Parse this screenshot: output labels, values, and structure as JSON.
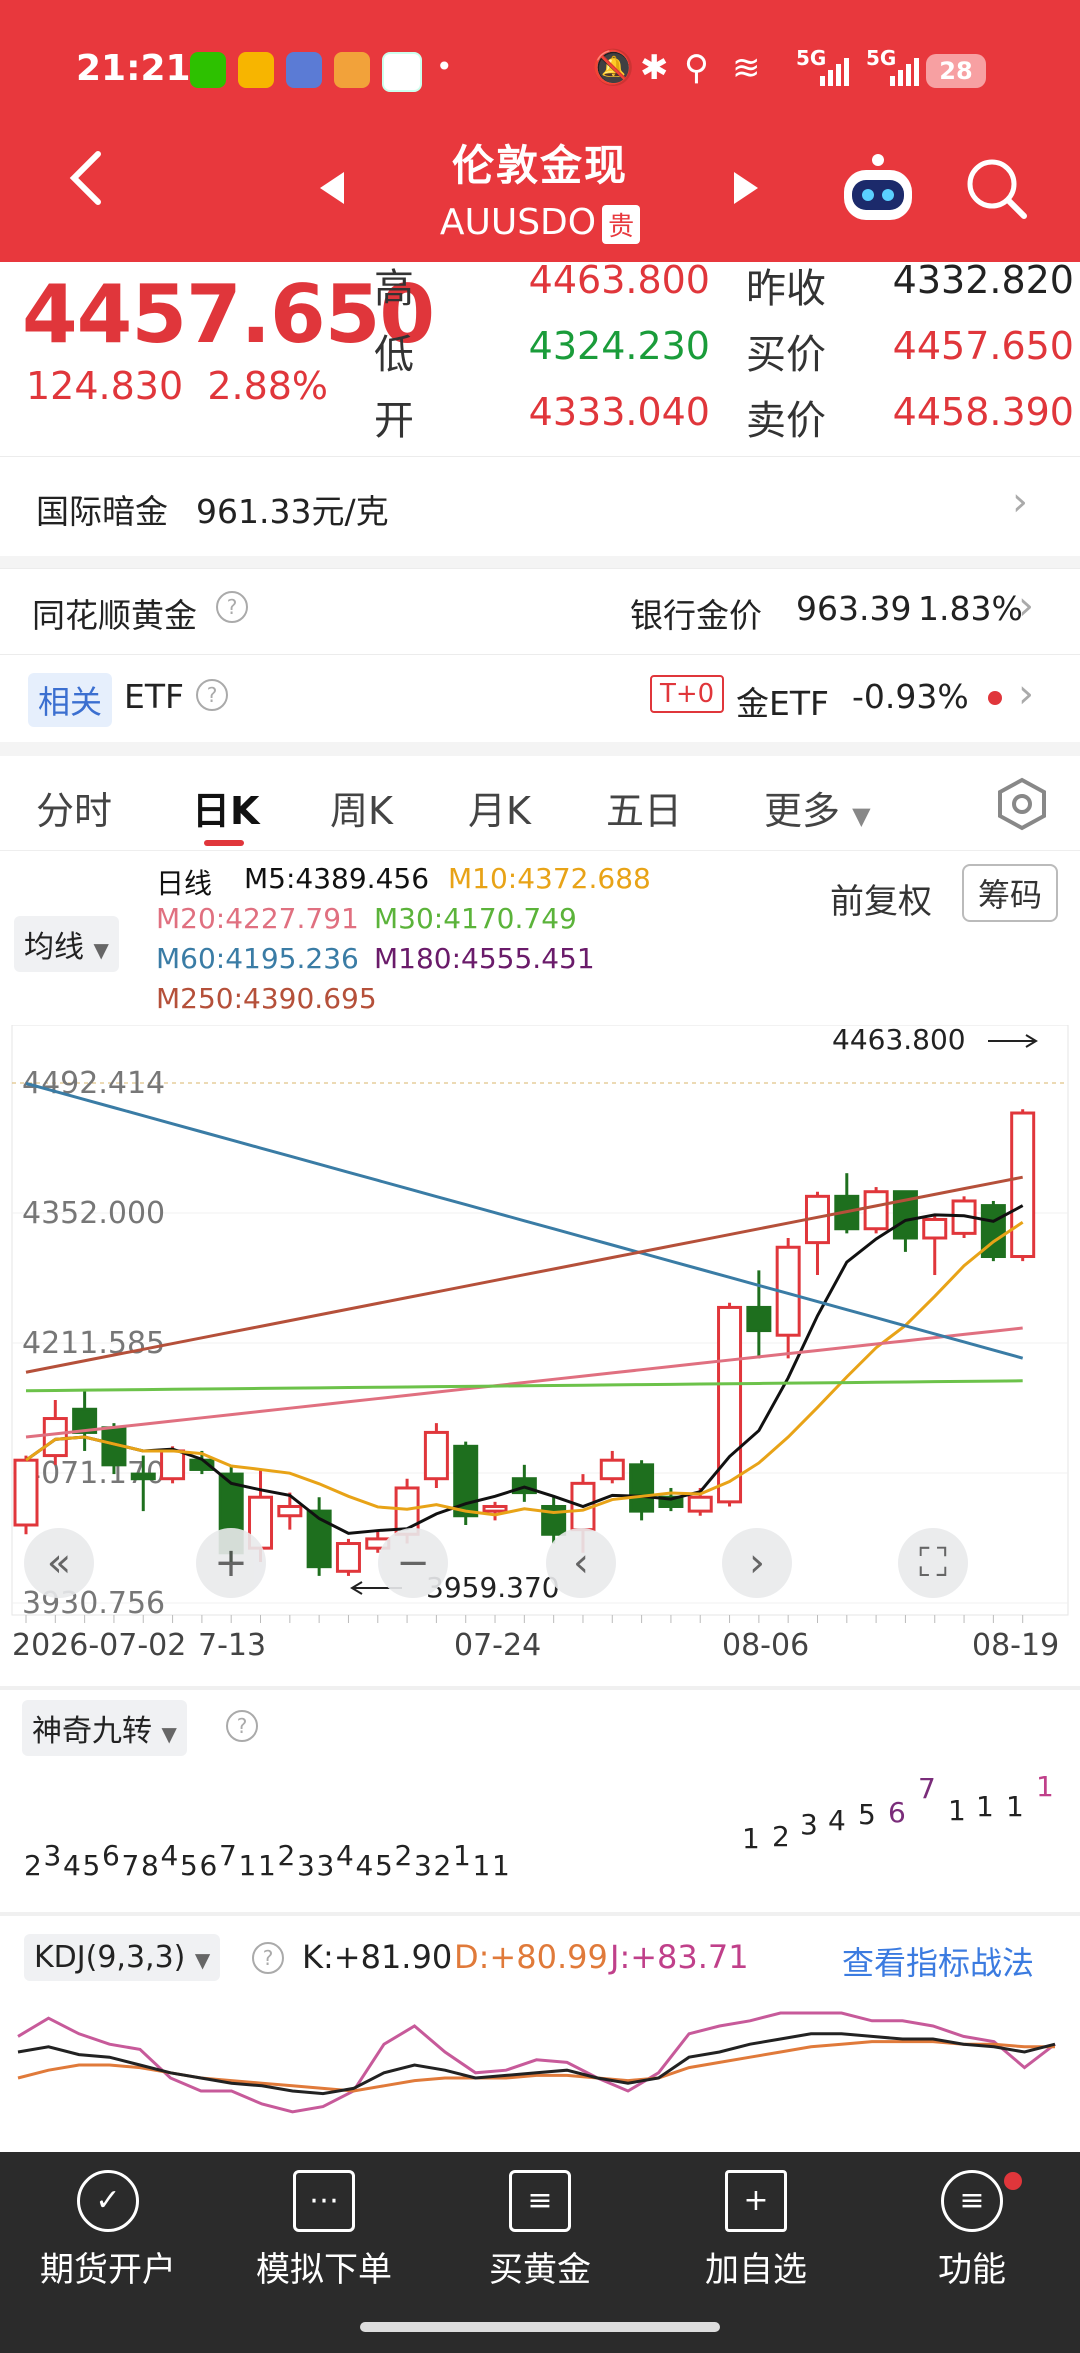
{
  "status_bar": {
    "time": "21:21",
    "dot": "•",
    "battery": "28",
    "signal1": "5G",
    "signal2": "5G"
  },
  "header": {
    "title": "伦敦金现",
    "symbol": "AUUSDO",
    "badge": "贵"
  },
  "quote": {
    "price": "4457.650",
    "change": "124.830",
    "change_pct": "2.88%",
    "high_label": "高",
    "high_value": "4463.800",
    "low_label": "低",
    "low_value": "4324.230",
    "open_label": "开",
    "open_value": "4333.040",
    "prev_close_label": "昨收",
    "prev_close_value": "4332.820",
    "bid_label": "买价",
    "bid_value": "4457.650",
    "ask_label": "卖价",
    "ask_value": "4458.390"
  },
  "intl_gold": {
    "label": "国际暗金",
    "value": "961.33元/克"
  },
  "ths_gold": {
    "label": "同花顺黄金",
    "bank_label": "银行金价",
    "bank_price": "963.39",
    "bank_pct": "1.83%"
  },
  "etf_row": {
    "tag": "相关",
    "label": "ETF",
    "tplus": "T+0",
    "name": "金ETF",
    "pct": "-0.93%"
  },
  "tabs": [
    "分时",
    "日K",
    "周K",
    "月K",
    "五日",
    "更多"
  ],
  "active_tab": "日K",
  "ma": {
    "title": "日线",
    "m5": "M5:4389.456",
    "m10": "M10:4372.688",
    "m20": "M20:4227.791",
    "m30": "M30:4170.749",
    "m60": "M60:4195.236",
    "m180": "M180:4555.451",
    "m250": "M250:4390.695"
  },
  "ma_selector": "均线",
  "fuquan": "前复权",
  "chouma": "筹码",
  "colors": {
    "red": "#e0363b",
    "green": "#1e6f1e",
    "m5": "#111111",
    "m10": "#e8a317",
    "m20": "#e07080",
    "m30": "#6cc24a",
    "m60": "#3a7ca5",
    "m180": "#6a1b6a",
    "m250": "#b5503a"
  },
  "chart_data": {
    "type": "candlestick",
    "y_ticks": [
      "4492.414",
      "4352.000",
      "4211.585",
      "4071.170",
      "3930.756"
    ],
    "x_labels": [
      "2026-07-02",
      "7-13",
      "07-24",
      "08-06",
      "08-19"
    ],
    "annotations": {
      "high": "4463.800",
      "low": "3959.370"
    },
    "ylim": [
      3930.756,
      4492.414
    ],
    "candles": [
      {
        "o": 4015,
        "c": 4085,
        "h": 4090,
        "l": 4005
      },
      {
        "o": 4090,
        "c": 4130,
        "h": 4150,
        "l": 4080
      },
      {
        "o": 4140,
        "c": 4115,
        "h": 4160,
        "l": 4095
      },
      {
        "o": 4120,
        "c": 4080,
        "h": 4125,
        "l": 4070
      },
      {
        "o": 4070,
        "c": 4065,
        "h": 4090,
        "l": 4030
      },
      {
        "o": 4065,
        "c": 4095,
        "h": 4100,
        "l": 4060
      },
      {
        "o": 4085,
        "c": 4075,
        "h": 4095,
        "l": 4070
      },
      {
        "o": 4070,
        "c": 3985,
        "h": 4080,
        "l": 3975
      },
      {
        "o": 3990,
        "c": 4045,
        "h": 4075,
        "l": 3975
      },
      {
        "o": 4025,
        "c": 4035,
        "h": 4050,
        "l": 4010
      },
      {
        "o": 4030,
        "c": 3970,
        "h": 4045,
        "l": 3960
      },
      {
        "o": 3965,
        "c": 3995,
        "h": 4000,
        "l": 3960
      },
      {
        "o": 3990,
        "c": 4000,
        "h": 4010,
        "l": 3985
      },
      {
        "o": 4005,
        "c": 4055,
        "h": 4065,
        "l": 3995
      },
      {
        "o": 4065,
        "c": 4115,
        "h": 4125,
        "l": 4055
      },
      {
        "o": 4100,
        "c": 4025,
        "h": 4105,
        "l": 4015
      },
      {
        "o": 4030,
        "c": 4035,
        "h": 4040,
        "l": 4020
      },
      {
        "o": 4065,
        "c": 4050,
        "h": 4080,
        "l": 4040
      },
      {
        "o": 4035,
        "c": 4005,
        "h": 4045,
        "l": 3995
      },
      {
        "o": 4010,
        "c": 4060,
        "h": 4070,
        "l": 3985
      },
      {
        "o": 4065,
        "c": 4085,
        "h": 4095,
        "l": 4060
      },
      {
        "o": 4080,
        "c": 4030,
        "h": 4085,
        "l": 4020
      },
      {
        "o": 4045,
        "c": 4035,
        "h": 4055,
        "l": 4030
      },
      {
        "o": 4030,
        "c": 4045,
        "h": 4055,
        "l": 4025
      },
      {
        "o": 4040,
        "c": 4250,
        "h": 4255,
        "l": 4035
      },
      {
        "o": 4250,
        "c": 4225,
        "h": 4290,
        "l": 4195
      },
      {
        "o": 4220,
        "c": 4315,
        "h": 4325,
        "l": 4195
      },
      {
        "o": 4320,
        "c": 4370,
        "h": 4375,
        "l": 4285
      },
      {
        "o": 4370,
        "c": 4335,
        "h": 4395,
        "l": 4330
      },
      {
        "o": 4335,
        "c": 4375,
        "h": 4380,
        "l": 4330
      },
      {
        "o": 4375,
        "c": 4325,
        "h": 4375,
        "l": 4310
      },
      {
        "o": 4325,
        "c": 4345,
        "h": 4350,
        "l": 4285
      },
      {
        "o": 4330,
        "c": 4365,
        "h": 4370,
        "l": 4325
      },
      {
        "o": 4360,
        "c": 4305,
        "h": 4365,
        "l": 4300
      },
      {
        "o": 4305,
        "c": 4460,
        "h": 4464,
        "l": 4300
      }
    ]
  },
  "nine": {
    "label": "神奇九转",
    "bottom": [
      "2",
      "3",
      "4",
      "5",
      "6",
      "7",
      "8",
      "4",
      "5",
      "6",
      "7",
      "1",
      "1",
      "2",
      "3",
      "3",
      "4",
      "4",
      "5",
      "2",
      "3",
      "2",
      "1",
      "1",
      "1"
    ],
    "top": [
      "1",
      "2",
      "3",
      "4",
      "5",
      "6",
      "7",
      "1",
      "1",
      "1",
      "1"
    ]
  },
  "kdj": {
    "name": "KDJ(9,3,3)",
    "k": "K:+81.90",
    "d": "D:+80.99",
    "j": "J:+83.71",
    "link": "查看指标战法"
  },
  "nav": [
    {
      "label": "期货开户",
      "icon": "✓"
    },
    {
      "label": "模拟下单",
      "icon": "⋯"
    },
    {
      "label": "买黄金",
      "icon": "≡"
    },
    {
      "label": "加自选",
      "icon": "+"
    },
    {
      "label": "功能",
      "icon": "≡"
    }
  ]
}
